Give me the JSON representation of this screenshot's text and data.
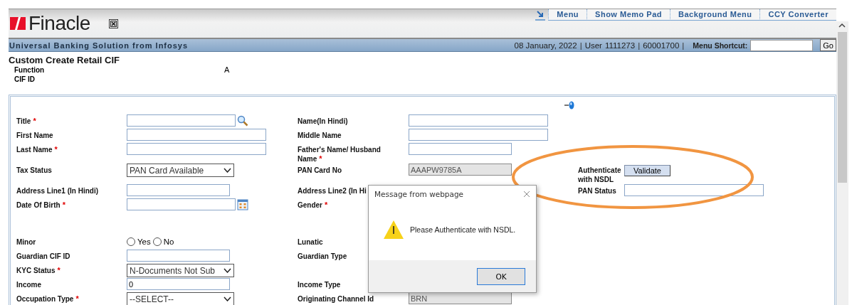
{
  "header": {
    "logo": "Finacle",
    "nav_links": [
      "Menu",
      "Show Memo Pad",
      "Background Menu",
      "CCY Converter"
    ],
    "tagline": "Universal Banking Solution from Infosys",
    "info_items": [
      {
        "kind": "date",
        "text": "08 January, 2022"
      },
      {
        "kind": "separator",
        "text": "|"
      },
      {
        "kind": "label",
        "text": "User"
      },
      {
        "kind": "user",
        "text": "1111273"
      },
      {
        "kind": "separator",
        "text": "|"
      },
      {
        "kind": "branch",
        "text": "60001700"
      },
      {
        "kind": "separator",
        "text": "|"
      }
    ],
    "shortcut_label": "Menu Shortcut:",
    "go": "Go"
  },
  "page_title": "Custom Create Retail CIF",
  "info": [
    {
      "label": "Function",
      "value": "A"
    },
    {
      "label": "CIF ID"
    }
  ],
  "form": {
    "rows": [
      {
        "cells": [
          {
            "label": "Title",
            "marker": "*",
            "field": {
              "kind": "lookup"
            }
          },
          {
            "label": "Name(In Hindi)",
            "field": {
              "kind": "text",
              "wide": true
            }
          }
        ]
      },
      {
        "cells": [
          {
            "label": "First Name",
            "field": {
              "kind": "text",
              "wide": true
            }
          },
          {
            "label": "Middle Name",
            "field": {
              "kind": "text",
              "wide": true
            }
          }
        ]
      },
      {
        "cells": [
          {
            "label": "Last Name",
            "marker": "*",
            "field": {
              "kind": "text",
              "wide": true
            }
          },
          {
            "label": "Father's Name/ Husband Name",
            "marker": "*",
            "field": {
              "kind": "text",
              "wide": false
            }
          }
        ]
      },
      {
        "cells": [
          {
            "label": "Tax Status",
            "field": {
              "kind": "select",
              "value": "PAN Card Available"
            }
          },
          {
            "label": "PAN Card No",
            "field": {
              "kind": "text",
              "value": "AAAPW9785A",
              "disabled": true,
              "wide": false
            }
          },
          {
            "label": "Authenticate with NSDL",
            "field": {
              "kind": "button",
              "value": "Validate"
            }
          }
        ]
      },
      {
        "cells": [
          {
            "label": "Address Line1 (In Hindi)",
            "field": {
              "kind": "text",
              "wide": false
            }
          },
          {
            "label": "Address Line2 (In Hi"
          },
          {
            "label": "PAN Status",
            "field": {
              "kind": "text",
              "wide": true
            }
          }
        ]
      },
      {
        "cells": [
          {
            "label": "Date Of Birth",
            "marker": "*",
            "field": {
              "kind": "date"
            }
          },
          {
            "label": "Gender",
            "marker": "*"
          }
        ]
      },
      {
        "cells": []
      },
      {
        "cells": [
          {
            "label": "Minor",
            "field": {
              "kind": "radio",
              "options": [
                {
                  "label": "Yes",
                  "selected": false
                },
                {
                  "label": "No",
                  "selected": false
                }
              ]
            }
          },
          {
            "label": "Lunatic"
          }
        ]
      },
      {
        "cells": [
          {
            "label": "Guardian CIF ID",
            "field": {
              "kind": "text",
              "wide": false
            }
          },
          {
            "label": "Guardian Type"
          }
        ]
      },
      {
        "cells": [
          {
            "label": "KYC Status",
            "marker": "*",
            "field": {
              "kind": "select",
              "value": "N-Documents Not Sub"
            }
          }
        ]
      },
      {
        "cells": [
          {
            "label": "Income",
            "field": {
              "kind": "text",
              "value": "0",
              "wide": false
            }
          },
          {
            "label": "Income Type"
          }
        ]
      },
      {
        "cells": [
          {
            "label": "Occupation Type",
            "marker": "*",
            "field": {
              "kind": "select",
              "value": "--SELECT--"
            }
          },
          {
            "label": "Originating Channel Id",
            "field": {
              "kind": "text",
              "value": "BRN",
              "disabled": true,
              "wide": false
            }
          }
        ]
      }
    ]
  },
  "dialog": {
    "title": "Message from webpage",
    "message": "Please Authenticate with NSDL.",
    "button": "OK"
  }
}
